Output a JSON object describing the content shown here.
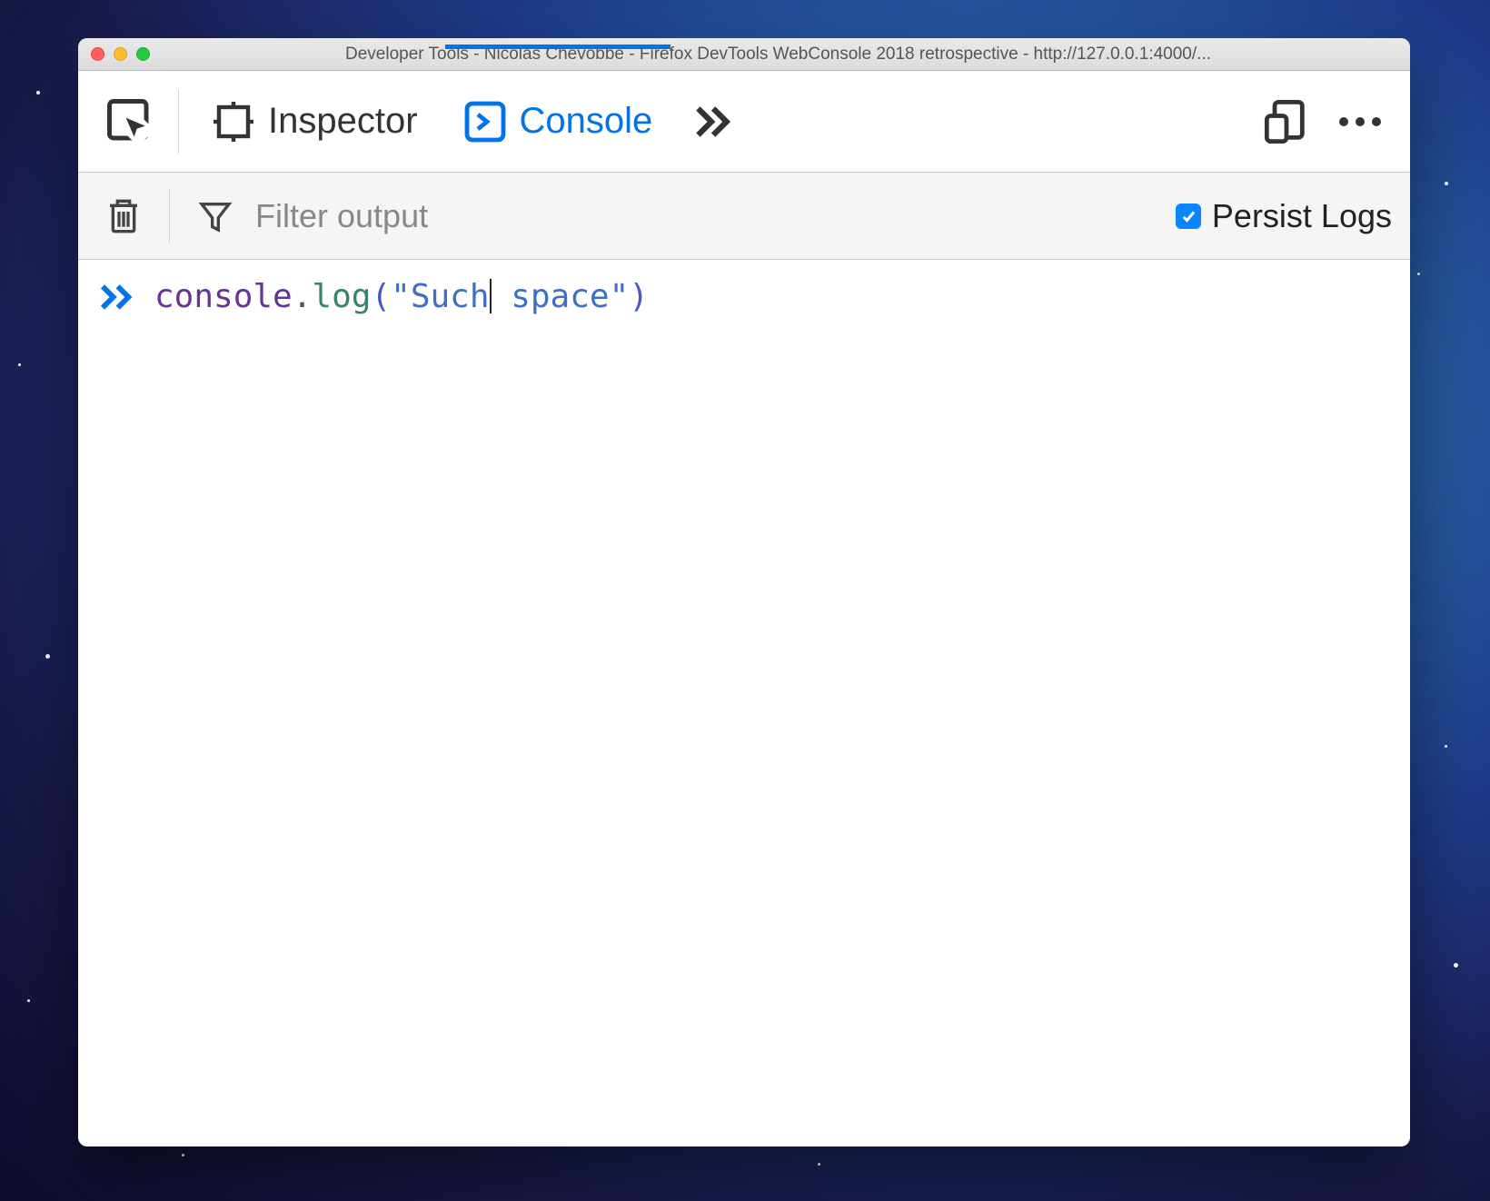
{
  "window": {
    "title": "Developer Tools - Nicolas Chevobbe - Firefox DevTools WebConsole 2018 retrospective - http://127.0.0.1:4000/..."
  },
  "toolbar": {
    "tabs": {
      "inspector": {
        "label": "Inspector"
      },
      "console": {
        "label": "Console"
      }
    }
  },
  "filterbar": {
    "placeholder": "Filter output",
    "persist_label": "Persist Logs",
    "persist_checked": true
  },
  "console": {
    "input_tokens": {
      "object": "console",
      "dot": ".",
      "fn": "log",
      "open": "(",
      "quote1": "\"",
      "str1": "Such",
      "str2": " space",
      "quote2": "\"",
      "close": ")"
    }
  }
}
